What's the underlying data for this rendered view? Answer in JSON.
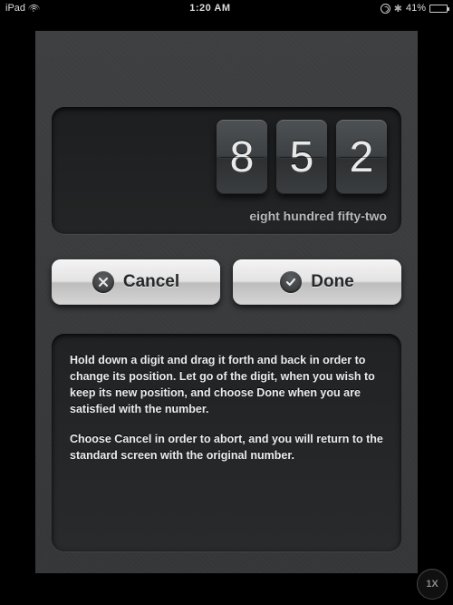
{
  "status_bar": {
    "device": "iPad",
    "time": "1:20 AM",
    "battery_pct": "41%",
    "battery_level": 41
  },
  "display": {
    "digits": [
      "8",
      "5",
      "2"
    ],
    "words": "eight hundred fifty-two"
  },
  "buttons": {
    "cancel": {
      "label": "Cancel"
    },
    "done": {
      "label": "Done"
    }
  },
  "help": {
    "p1": "Hold down a digit and drag it forth and back in order to change its position. Let go of the digit, when you wish to keep its new position, and choose Done when you are satisfied with the number.",
    "p2": "Choose Cancel in order to abort, and you will return to the standard screen with the original number."
  },
  "scale_badge": "1X"
}
